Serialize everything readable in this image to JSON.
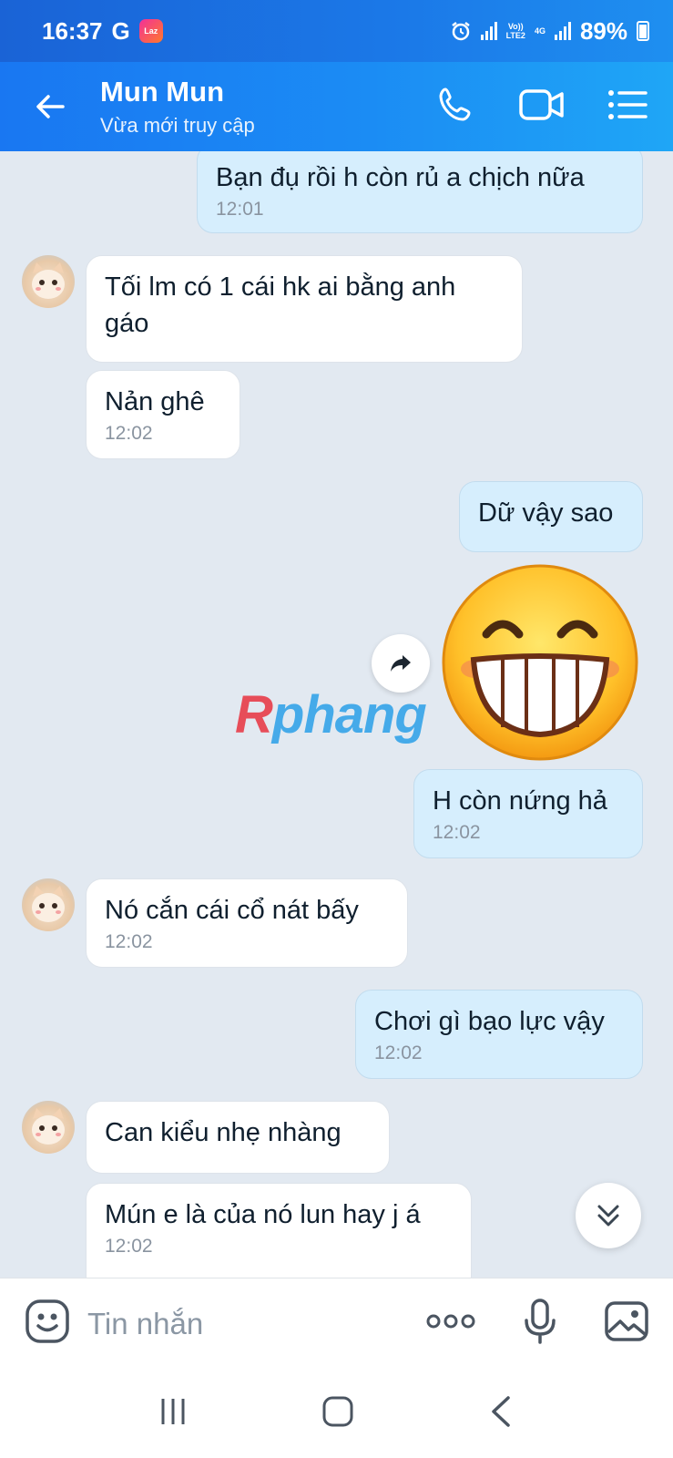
{
  "status_bar": {
    "time": "16:37",
    "g_label": "G",
    "laz_label": "Laz",
    "volte_label": "Vo))\nLTE2",
    "net_label": "4G",
    "battery": "89%"
  },
  "header": {
    "name": "Mun Mun",
    "status": "Vừa mới truy cập"
  },
  "messages": [
    {
      "dir": "out",
      "text": "Bạn đụ rồi h còn rủ a chịch nữa",
      "time": "12:01"
    },
    {
      "dir": "in",
      "text": "Tối lm có 1 cái hk ai bằng anh gáo",
      "time": ""
    },
    {
      "dir": "in",
      "text": "Nản ghê",
      "time": "12:02"
    },
    {
      "dir": "out",
      "text": "Dữ vậy sao",
      "time": ""
    },
    {
      "dir": "out",
      "text": "H còn nứng hả",
      "time": "12:02"
    },
    {
      "dir": "in",
      "text": "Nó cắn cái cổ nát bấy",
      "time": "12:02"
    },
    {
      "dir": "out",
      "text": "Chơi gì bạo lực vậy",
      "time": "12:02"
    },
    {
      "dir": "in",
      "text": "Can kiểu nhẹ nhàng",
      "time": ""
    },
    {
      "dir": "in",
      "text": "Mún e là của nó lun hay j á",
      "time": "12:02"
    }
  ],
  "watermark": {
    "first": "R",
    "rest": "phang"
  },
  "input": {
    "placeholder": "Tin nhắn"
  },
  "icons": {
    "back": "arrow-left-icon",
    "call": "phone-icon",
    "video": "video-camera-icon",
    "menu": "list-menu-icon",
    "sticker": "smiley-icon",
    "more": "more-dots-icon",
    "mic": "microphone-icon",
    "image": "image-icon"
  },
  "colors": {
    "header": "#1b8cf4",
    "outgoing_bubble": "#d6eefd",
    "chat_bg": "#e2e9f1"
  }
}
